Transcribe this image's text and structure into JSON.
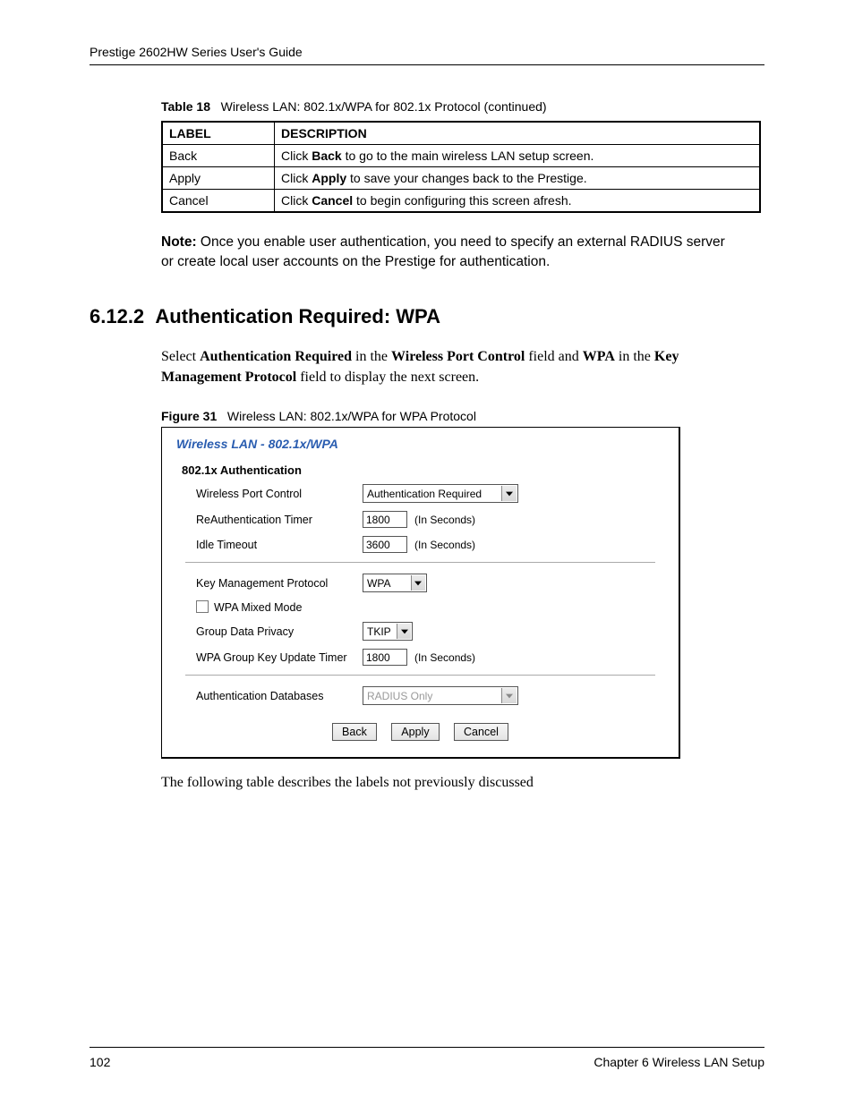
{
  "header": {
    "guide_title": "Prestige 2602HW Series User's Guide"
  },
  "table18": {
    "caption_label": "Table 18",
    "caption_text": "Wireless LAN: 802.1x/WPA for 802.1x Protocol (continued)",
    "col_label": "LABEL",
    "col_desc": "DESCRIPTION",
    "rows": [
      {
        "label": "Back",
        "d1": "Click ",
        "db": "Back",
        "d2": " to go to the main wireless LAN setup screen."
      },
      {
        "label": "Apply",
        "d1": "Click ",
        "db": "Apply",
        "d2": " to save your changes back to the Prestige."
      },
      {
        "label": "Cancel",
        "d1": "Click ",
        "db": "Cancel",
        "d2": " to begin configuring this screen afresh."
      }
    ]
  },
  "note": {
    "prefix": "Note:",
    "text": "Once you enable user authentication, you need to specify an external RADIUS server or create local user accounts on the Prestige for authentication."
  },
  "section": {
    "number": "6.12.2",
    "title": "Authentication Required: WPA"
  },
  "intro": {
    "p1": "Select ",
    "b1": "Authentication Required",
    "p2": " in the ",
    "b2": "Wireless Port Control",
    "p3": " field and ",
    "b3": "WPA",
    "p4": " in the ",
    "b4": "Key Management Protocol",
    "p5": " field to display the next screen."
  },
  "figure": {
    "caption_label": "Figure 31",
    "caption_text": "Wireless LAN: 802.1x/WPA for WPA Protocol",
    "panel_title": "Wireless LAN - 802.1x/WPA",
    "section1_head": "802.1x Authentication",
    "labels": {
      "wireless_port_control": "Wireless Port Control",
      "reauth_timer": "ReAuthentication Timer",
      "idle_timeout": "Idle Timeout",
      "key_mgmt": "Key Management Protocol",
      "wpa_mixed": "WPA Mixed Mode",
      "group_privacy": "Group Data Privacy",
      "wpa_group_timer": "WPA Group Key Update Timer",
      "auth_db": "Authentication Databases"
    },
    "values": {
      "wireless_port_control": "Authentication Required",
      "reauth_timer": "1800",
      "idle_timeout": "3600",
      "key_mgmt": "WPA",
      "group_privacy": "TKIP",
      "wpa_group_timer": "1800",
      "auth_db": "RADIUS Only"
    },
    "suffix_seconds": "(In Seconds)",
    "buttons": {
      "back": "Back",
      "apply": "Apply",
      "cancel": "Cancel"
    }
  },
  "after_figure": "The following table describes the labels not previously discussed",
  "footer": {
    "page_number": "102",
    "chapter": "Chapter 6 Wireless LAN Setup"
  }
}
